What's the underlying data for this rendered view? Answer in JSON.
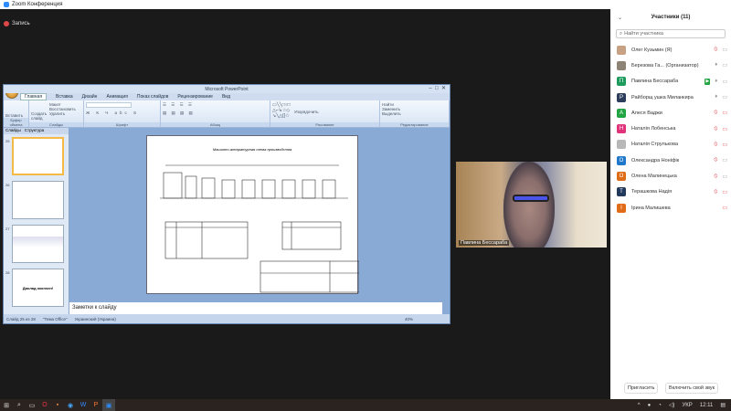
{
  "window": {
    "title": "Zoom Конференция"
  },
  "recording": {
    "label": "Запись"
  },
  "powerpoint": {
    "title": "Microsoft PowerPoint",
    "tabs": [
      "Главная",
      "Вставка",
      "Дизайн",
      "Анимация",
      "Показ слайдов",
      "Рецензирование",
      "Вид"
    ],
    "groups": [
      "Буфер обмена",
      "Слайды",
      "Шрифт",
      "Абзац",
      "Рисование",
      "Редактирование"
    ],
    "buttons": {
      "paste": "Вставить",
      "new_slide": "Создать слайд",
      "layout": "Макет",
      "reset": "Восстановить",
      "delete": "Удалить",
      "arrange": "Упорядочить",
      "find": "Найти",
      "replace": "Заменить",
      "select": "Выделить"
    },
    "pane_tabs": [
      "Слайды",
      "Структура"
    ],
    "slide_numbers": [
      "25",
      "26",
      "27",
      "28"
    ],
    "slide_title": "Машинно-аппаратурная схема производства",
    "thumb_last_text": "Доклад окончен!",
    "notes_placeholder": "Заметки к слайду",
    "status": [
      "Слайд 25 из 28",
      "\"Тема Office\"",
      "Украинский (Украина)"
    ],
    "zoom": "40%"
  },
  "video": {
    "name": "Павлина Бессараба"
  },
  "participants": {
    "title": "Участники (11)",
    "search_placeholder": "Найти участника",
    "list": [
      {
        "name": "Олег Кузьмин (Я)",
        "initial": "",
        "color": "#c8a083",
        "mic": "muted",
        "video": "off"
      },
      {
        "name": "Березова Га... (Организатор)",
        "initial": "",
        "color": "#8f8276",
        "mic": "on",
        "video": "off"
      },
      {
        "name": "Павлина Бессараба",
        "initial": "П",
        "color": "#1d9b5c",
        "mic": "on",
        "video": "on"
      },
      {
        "name": "Райборщ ушка Миланкира",
        "initial": "Р",
        "color": "#2b3d5a",
        "mic": "on",
        "video": "off"
      },
      {
        "name": "Алеся Ваджи",
        "initial": "А",
        "color": "#23a543",
        "mic": "muted",
        "video": "muted"
      },
      {
        "name": "Наталія Лобенська",
        "initial": "Н",
        "color": "#e0337a",
        "mic": "muted",
        "video": "muted"
      },
      {
        "name": "Наталія Струлькова",
        "initial": "",
        "color": "#b8b8b8",
        "mic": "muted",
        "video": "muted"
      },
      {
        "name": "Олександра Ноніфік",
        "initial": "О",
        "color": "#1f78c8",
        "mic": "muted",
        "video": "off"
      },
      {
        "name": "Олена Малинецька",
        "initial": "О",
        "color": "#e06c17",
        "mic": "muted",
        "video": "off"
      },
      {
        "name": "Терашкова Надія",
        "initial": "Т",
        "color": "#22395c",
        "mic": "muted",
        "video": "muted"
      },
      {
        "name": "Ірина Малишева",
        "initial": "І",
        "color": "#e06c17",
        "mic": "",
        "video": "muted"
      }
    ],
    "invite": "Пригласить",
    "unmute": "Включить свой звук"
  },
  "taskbar": {
    "lang": "УКР",
    "time": "12:11"
  }
}
